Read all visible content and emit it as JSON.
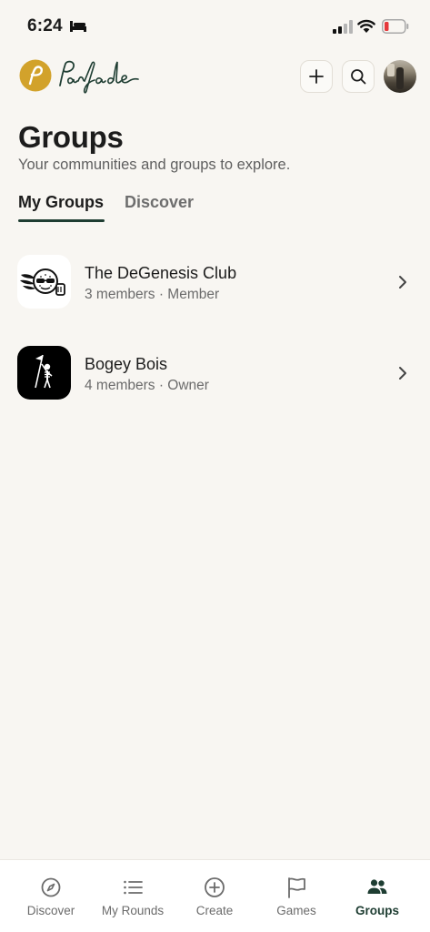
{
  "status_bar": {
    "time": "6:24",
    "icons": [
      "bed-icon",
      "cellular-signal-icon",
      "wifi-icon",
      "battery-low-icon"
    ],
    "battery_color": "#e5383b"
  },
  "header": {
    "app_name": "Parfade",
    "brand_color": "#d2a22b",
    "logo_text_color": "#1e3d32",
    "actions": [
      "plus-icon",
      "search-icon",
      "avatar"
    ]
  },
  "page": {
    "title": "Groups",
    "subtitle": "Your communities and groups to explore."
  },
  "tabs": [
    {
      "label": "My Groups",
      "active": true
    },
    {
      "label": "Discover",
      "active": false
    }
  ],
  "groups": [
    {
      "name": "The DeGenesis Club",
      "meta": "3 members · Member",
      "icon": "winged-golf-ball-logo"
    },
    {
      "name": "Bogey Bois",
      "meta": "4 members · Owner",
      "icon": "skeleton-flag-logo"
    }
  ],
  "bottom_nav": [
    {
      "label": "Discover",
      "icon": "compass-icon",
      "active": false
    },
    {
      "label": "My Rounds",
      "icon": "list-icon",
      "active": false
    },
    {
      "label": "Create",
      "icon": "plus-circle-icon",
      "active": false
    },
    {
      "label": "Games",
      "icon": "flag-icon",
      "active": false
    },
    {
      "label": "Groups",
      "icon": "people-icon",
      "active": true
    }
  ],
  "colors": {
    "background": "#f8f6f2",
    "accent": "#1e3d32",
    "text_secondary": "#6b6b6b"
  }
}
